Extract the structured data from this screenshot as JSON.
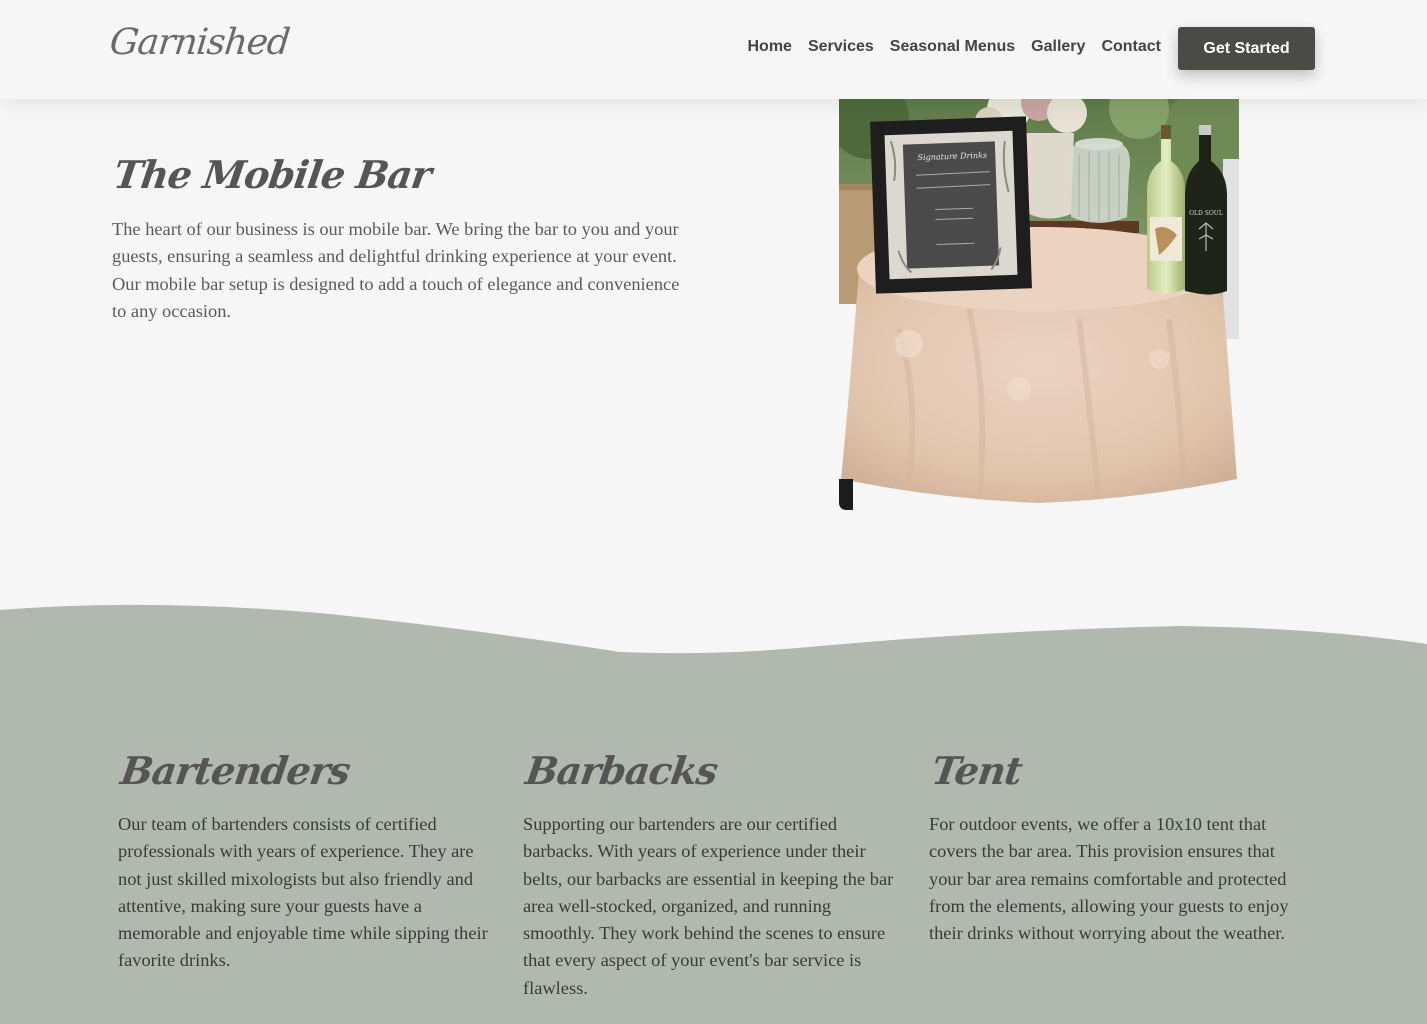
{
  "brand": {
    "logo_text": "Garnished"
  },
  "nav": {
    "items": [
      {
        "label": "Home"
      },
      {
        "label": "Services"
      },
      {
        "label": "Seasonal Menus"
      },
      {
        "label": "Gallery"
      },
      {
        "label": "Contact"
      }
    ],
    "cta_label": "Get Started"
  },
  "hero": {
    "title": "The Mobile Bar",
    "text": "The heart of our business is our mobile bar. We bring the bar to you and your guests, ensuring a seamless and delightful drinking experience at your event. Our mobile bar setup is designed to add a touch of elegance and convenience to any occasion.",
    "photo_sign_text": "Signature Drinks",
    "photo_bottle_1_label": "",
    "photo_bottle_2_label": "OLD SOUL"
  },
  "services": [
    {
      "title": "Bartenders",
      "text": "Our team of bartenders consists of certified professionals with years of experience. They are not just skilled mixologists but also friendly and attentive, making sure your guests have a memorable and enjoyable time while sipping their favorite drinks."
    },
    {
      "title": "Barbacks",
      "text": "Supporting our bartenders are our certified barbacks. With years of experience under their belts, our barbacks are essential in keeping the bar area well-stocked, organized, and running smoothly. They work behind the scenes to ensure that every aspect of your event's bar service is flawless."
    },
    {
      "title": "Tent",
      "text": "For outdoor events, we offer a 10x10 tent that covers the bar area. This provision ensures that your bar area remains comfortable and protected from the elements, allowing your guests to enjoy their drinks without worrying about the weather."
    }
  ],
  "colors": {
    "background": "#f6f6f6",
    "services_background": "#b1b8ad",
    "button": "#4a4b47",
    "heading": "#555555"
  }
}
